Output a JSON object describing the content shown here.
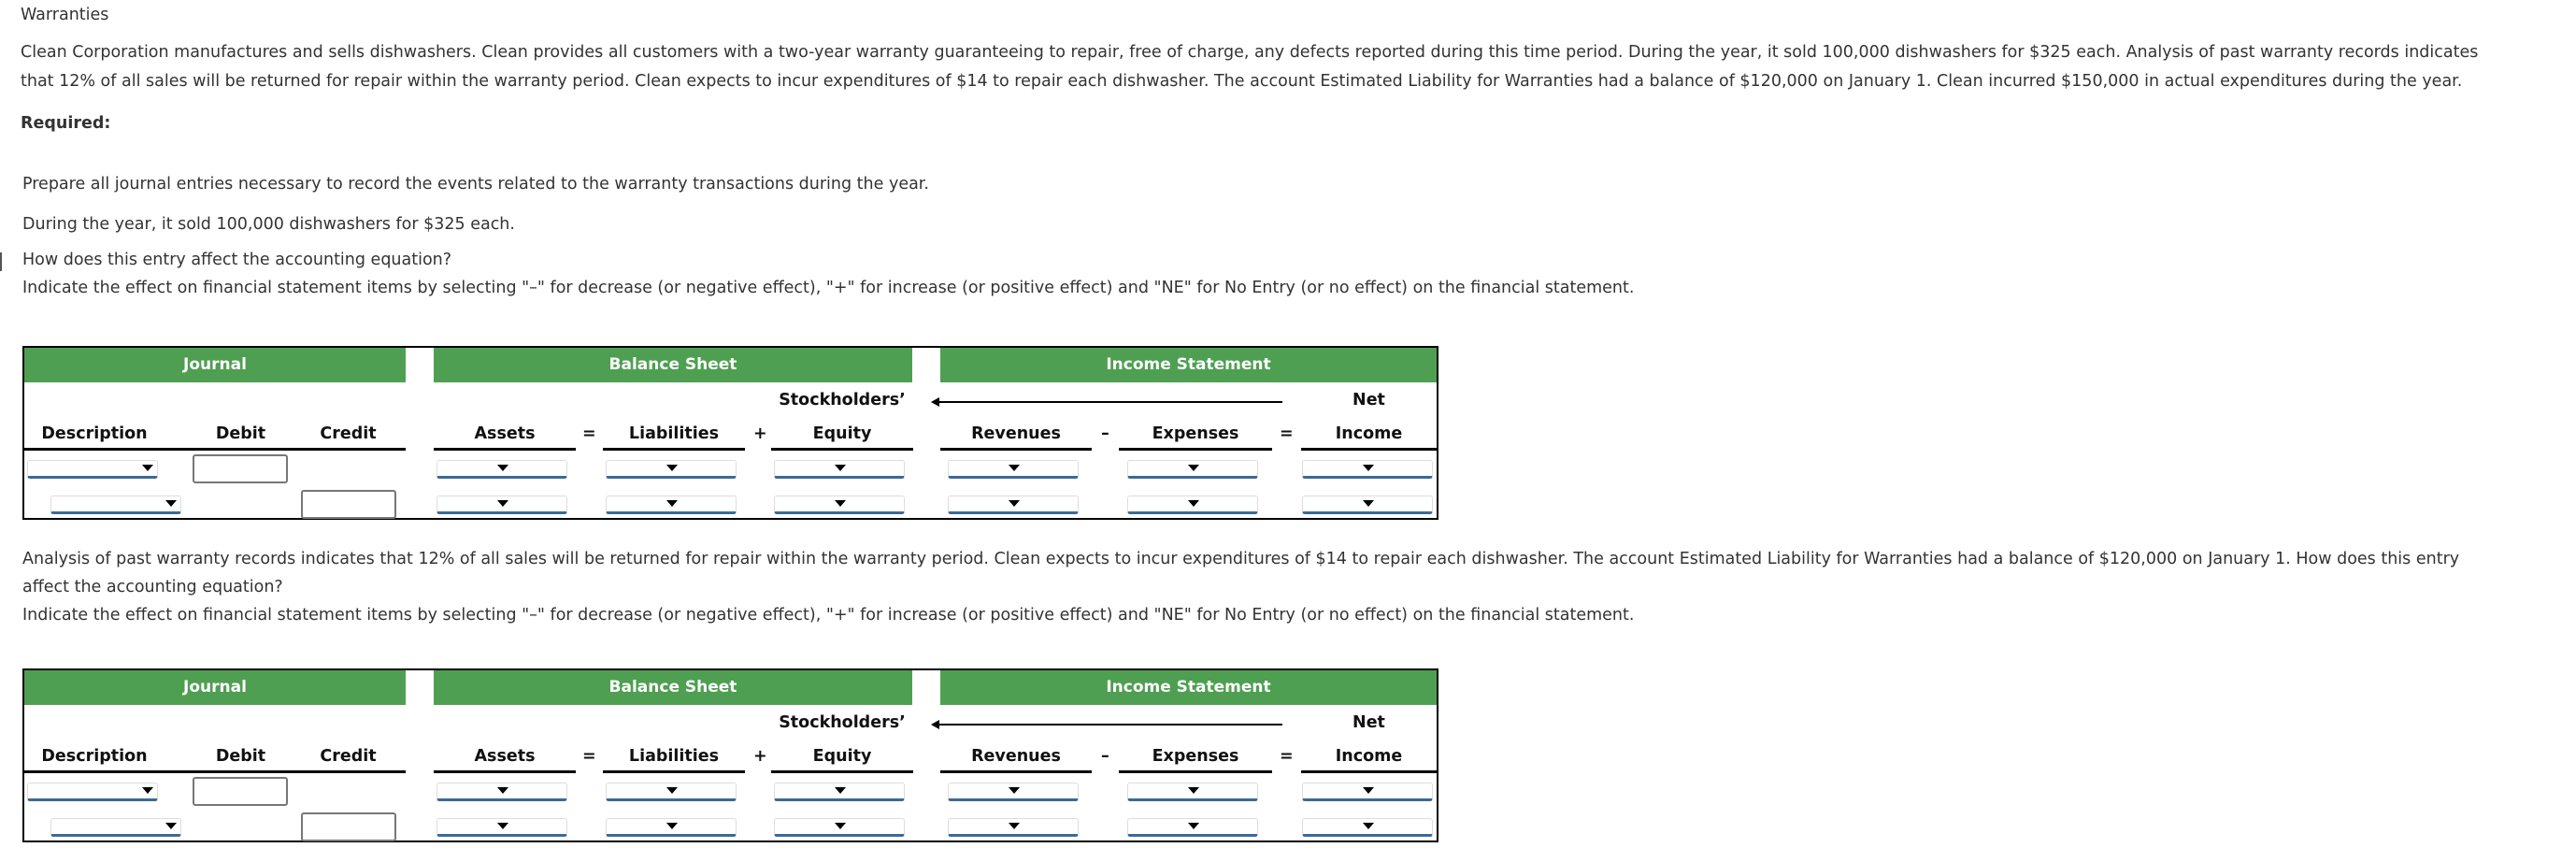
{
  "title": "Warranties",
  "problem": {
    "line1": "Clean Corporation manufactures and sells dishwashers. Clean provides all customers with a two-year warranty guaranteeing to repair, free of charge, any defects reported during this time period. During the year, it sold 100,000 dishwashers for $325 each. Analysis of past warranty records indicates",
    "line2": "that 12% of all sales will be returned for repair within the warranty period. Clean expects to incur expenditures of $14 to repair each dishwasher. The account Estimated Liability for Warranties had a balance of $120,000 on January 1. Clean incurred $150,000 in actual expenditures during the year."
  },
  "required_label": "Required:",
  "instruction": "Prepare all journal entries necessary to record the events related to the warranty transactions during the year.",
  "sections": [
    {
      "event": "During the year, it sold 100,000 dishwashers for $325 each.",
      "question": "How does this entry affect the accounting equation?",
      "indicate": "Indicate the effect on financial statement items by selecting \"–\" for decrease (or negative effect), \"+\" for increase (or positive effect) and \"NE\" for No Entry (or no effect) on the financial statement."
    },
    {
      "event_line1": "Analysis of past warranty records indicates that 12% of all sales will be returned for repair within the warranty period. Clean expects to incur expenditures of $14 to repair each dishwasher. The account Estimated Liability for Warranties had a balance of $120,000 on January 1. How does this entry",
      "event_line2": "affect the accounting equation?",
      "indicate": "Indicate the effect on financial statement items by selecting \"–\" for decrease (or negative effect), \"+\" for increase (or positive effect) and \"NE\" for No Entry (or no effect) on the financial statement."
    }
  ],
  "table": {
    "groups": {
      "journal": "Journal",
      "balance_sheet": "Balance Sheet",
      "income_statement": "Income Statement"
    },
    "headers": {
      "description": "Description",
      "debit": "Debit",
      "credit": "Credit",
      "assets": "Assets",
      "liabilities": "Liabilities",
      "stockholders": "Stockholders’",
      "equity": "Equity",
      "revenues": "Revenues",
      "expenses": "Expenses",
      "net": "Net",
      "income": "Income"
    },
    "operators": {
      "eq1": "=",
      "plus": "+",
      "minus": "–",
      "eq2": "="
    },
    "rows": [
      {
        "description": "",
        "debit": "",
        "assets": "",
        "liabilities": "",
        "equity": "",
        "revenues": "",
        "expenses": "",
        "net_income": ""
      },
      {
        "description": "",
        "credit": "",
        "assets": "",
        "liabilities": "",
        "equity": "",
        "revenues": "",
        "expenses": "",
        "net_income": ""
      }
    ]
  }
}
